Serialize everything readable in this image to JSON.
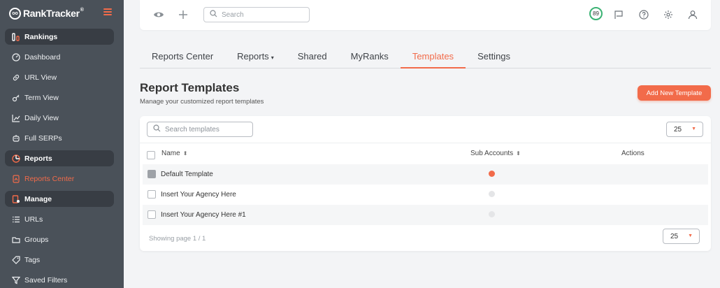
{
  "app": {
    "logo_mark": "oo",
    "logo_text": "RankTracker",
    "logo_sup": "®"
  },
  "sidebar": {
    "items": [
      {
        "label": "Rankings",
        "icon": "rankings-icon",
        "kind": "section"
      },
      {
        "label": "Dashboard",
        "icon": "dashboard-icon"
      },
      {
        "label": "URL View",
        "icon": "link-icon"
      },
      {
        "label": "Term View",
        "icon": "key-icon"
      },
      {
        "label": "Daily View",
        "icon": "line-chart-icon"
      },
      {
        "label": "Full SERPs",
        "icon": "robot-icon"
      },
      {
        "label": "Reports",
        "icon": "pie-chart-icon",
        "kind": "section"
      },
      {
        "label": "Reports Center",
        "icon": "report-doc-icon",
        "active": true
      },
      {
        "label": "Manage",
        "icon": "manage-icon",
        "kind": "section"
      },
      {
        "label": "URLs",
        "icon": "list-icon"
      },
      {
        "label": "Groups",
        "icon": "folder-icon"
      },
      {
        "label": "Tags",
        "icon": "tag-icon"
      },
      {
        "label": "Saved Filters",
        "icon": "filter-icon"
      }
    ]
  },
  "topbar": {
    "search_placeholder": "Search",
    "score": "89"
  },
  "tabs": [
    {
      "label": "Reports Center"
    },
    {
      "label": "Reports",
      "caret": "▾"
    },
    {
      "label": "Shared"
    },
    {
      "label": "MyRanks"
    },
    {
      "label": "Templates",
      "active": true
    },
    {
      "label": "Settings"
    }
  ],
  "page": {
    "title": "Report Templates",
    "subtitle": "Manage your customized report templates",
    "add_button": "Add New Template"
  },
  "table": {
    "search_placeholder": "Search templates",
    "per_page": "25",
    "columns": {
      "name": "Name",
      "sub_accounts": "Sub Accounts",
      "actions": "Actions"
    },
    "sort_glyph": "⬍",
    "rows": [
      {
        "name": "Default Template",
        "sub_accounts": true
      },
      {
        "name": "Insert Your Agency Here",
        "sub_accounts": false
      },
      {
        "name": "Insert Your Agency Here #1",
        "sub_accounts": false
      }
    ],
    "footer": "Showing page 1 / 1",
    "footer_per_page": "25"
  },
  "colors": {
    "accent": "#f26b4a",
    "sidebar_bg": "#4a5159",
    "score_ring": "#3bb273",
    "dot_on": "#f26b4a",
    "dot_off": "#e4e5e7"
  }
}
